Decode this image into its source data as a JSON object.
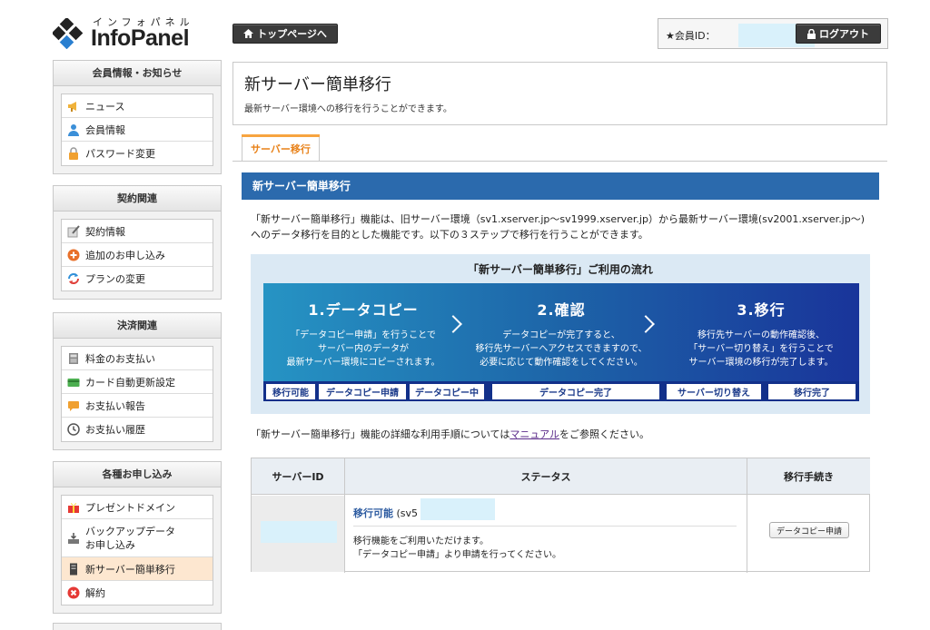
{
  "header": {
    "logo_kana": "インフォパネル",
    "logo_text": "InfoPanel",
    "top_button": "トップページへ",
    "member_label": "★会員ID：",
    "logout_button": "ログアウト"
  },
  "sidebar": {
    "sections": [
      {
        "title": "会員情報・お知らせ",
        "items": [
          "ニュース",
          "会員情報",
          "パスワード変更"
        ]
      },
      {
        "title": "契約関連",
        "items": [
          "契約情報",
          "追加のお申し込み",
          "プランの変更"
        ]
      },
      {
        "title": "決済関連",
        "items": [
          "料金のお支払い",
          "カード自動更新設定",
          "お支払い報告",
          "お支払い履歴"
        ]
      },
      {
        "title": "各種お申し込み",
        "items": [
          "プレゼントドメイン",
          "バックアップデータ",
          "お申し込み",
          "新サーバー簡単移行",
          "解約"
        ]
      }
    ]
  },
  "main": {
    "title": "新サーバー簡単移行",
    "description": "最新サーバー環境への移行を行うことができます。",
    "tab_label": "サーバー移行",
    "section_title": "新サーバー簡単移行",
    "intro_line1": "「新サーバー簡単移行」機能は、旧サーバー環境（sv1.xserver.jp〜sv1999.xserver.jp）から最新サーバー環境(sv2001.xserver.jp〜)",
    "intro_line2": "へのデータ移行を目的とした機能です。以下の３ステップで移行を行うことができます。",
    "flow": {
      "title": "「新サーバー簡単移行」ご利用の流れ",
      "steps": [
        {
          "title": "1.データコピー",
          "desc1": "「データコピー申請」を行うことで",
          "desc2": "サーバー内のデータが",
          "desc3": "最新サーバー環境にコピーされます。"
        },
        {
          "title": "2.確認",
          "desc1": "データコピーが完了すると、",
          "desc2": "移行先サーバーへアクセスできますので、",
          "desc3": "必要に応じて動作確認をしてください。"
        },
        {
          "title": "3.移行",
          "desc1": "移行先サーバーの動作確認後、",
          "desc2": "「サーバー切り替え」を行うことで",
          "desc3": "サーバー環境の移行が完了します。"
        }
      ],
      "statuses": [
        "移行可能",
        "データコピー申請",
        "データコピー中",
        "データコピー完了",
        "サーバー切り替え",
        "移行完了"
      ]
    },
    "manual_before": "「新サーバー簡単移行」機能の詳細な利用手順については",
    "manual_link": "マニュアル",
    "manual_after": "をご参照ください。",
    "table": {
      "headers": [
        "サーバーID",
        "ステータス",
        "移行手続き"
      ],
      "status_label": "移行可能",
      "status_suffix": "(sv5",
      "note1": "移行機能をご利用いただけます。",
      "note2": "「データコピー申請」より申請を行ってください。",
      "action_button": "データコピー申請"
    }
  }
}
